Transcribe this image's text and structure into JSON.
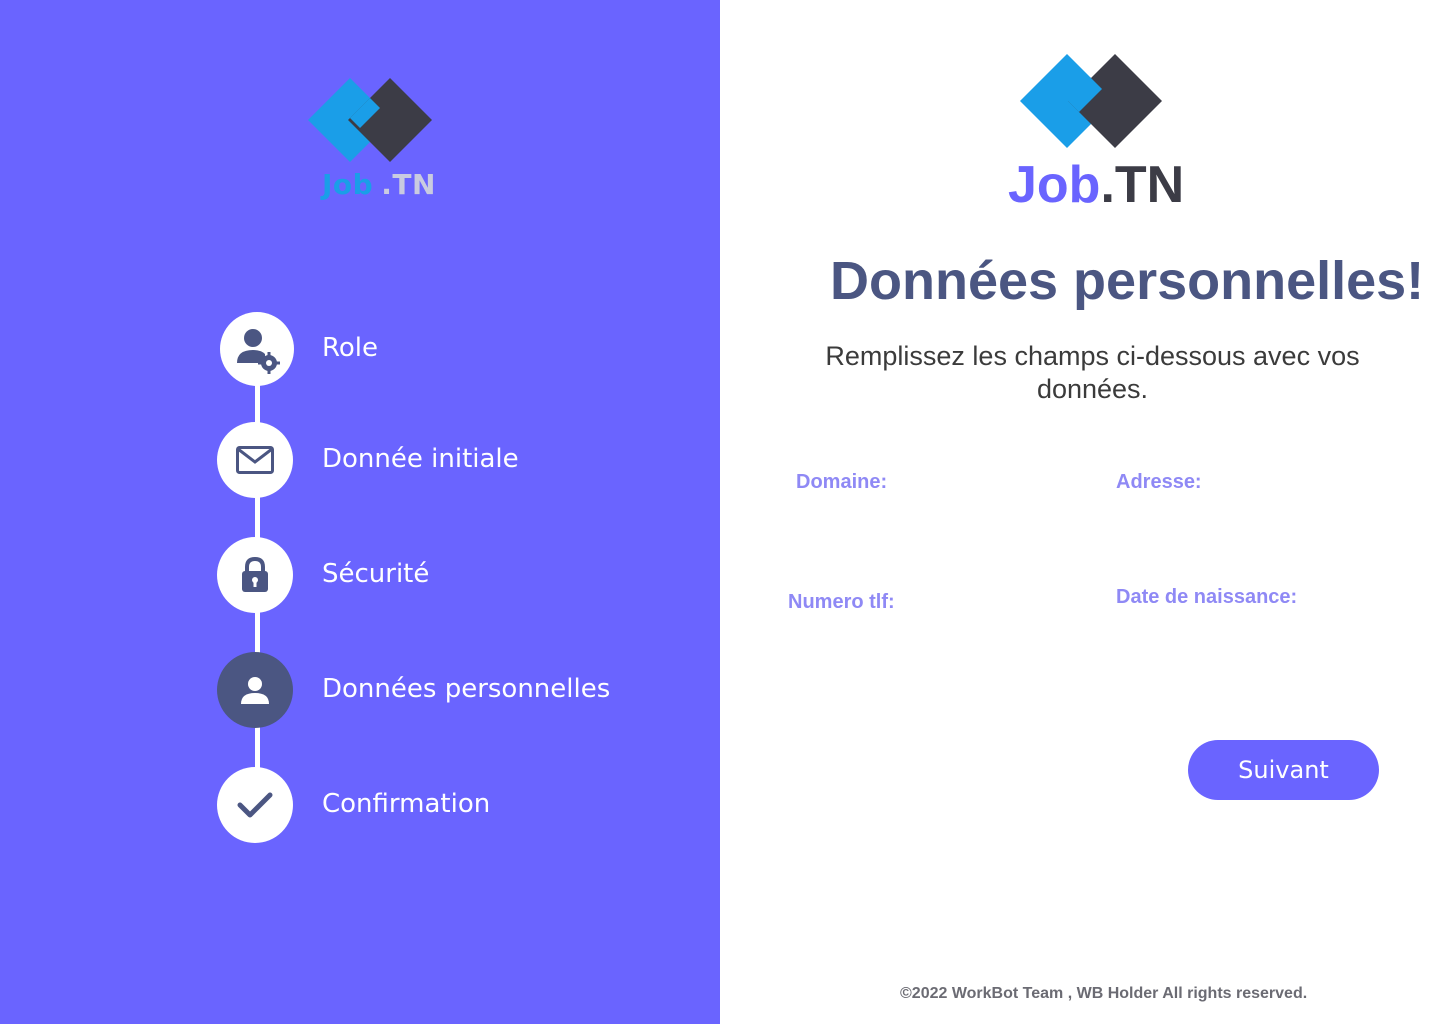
{
  "brand": {
    "job": "Job",
    "tn": ".TN",
    "colors": {
      "primary": "#6a64ff",
      "logo_blue": "#1a9ee8",
      "logo_dark": "#3c3c46",
      "step_active": "#4b5682"
    }
  },
  "steps": [
    {
      "label": "Role",
      "icon": "user-gear-icon",
      "active": false
    },
    {
      "label": "Donnée initiale",
      "icon": "envelope-icon",
      "active": false
    },
    {
      "label": "Sécurité",
      "icon": "lock-icon",
      "active": false
    },
    {
      "label": "Données personnelles",
      "icon": "user-icon",
      "active": true
    },
    {
      "label": "Confirmation",
      "icon": "check-icon",
      "active": false
    }
  ],
  "main": {
    "title": "Données personnelles!",
    "subtitle": "Remplissez les champs ci-dessous avec vos données.",
    "fields": {
      "domaine": "Domaine:",
      "adresse": "Adresse:",
      "numero": "Numero tlf:",
      "date": "Date de naissance:"
    },
    "next_label": "Suivant"
  },
  "footer": "©2022 WorkBot Team , WB Holder All rights reserved."
}
